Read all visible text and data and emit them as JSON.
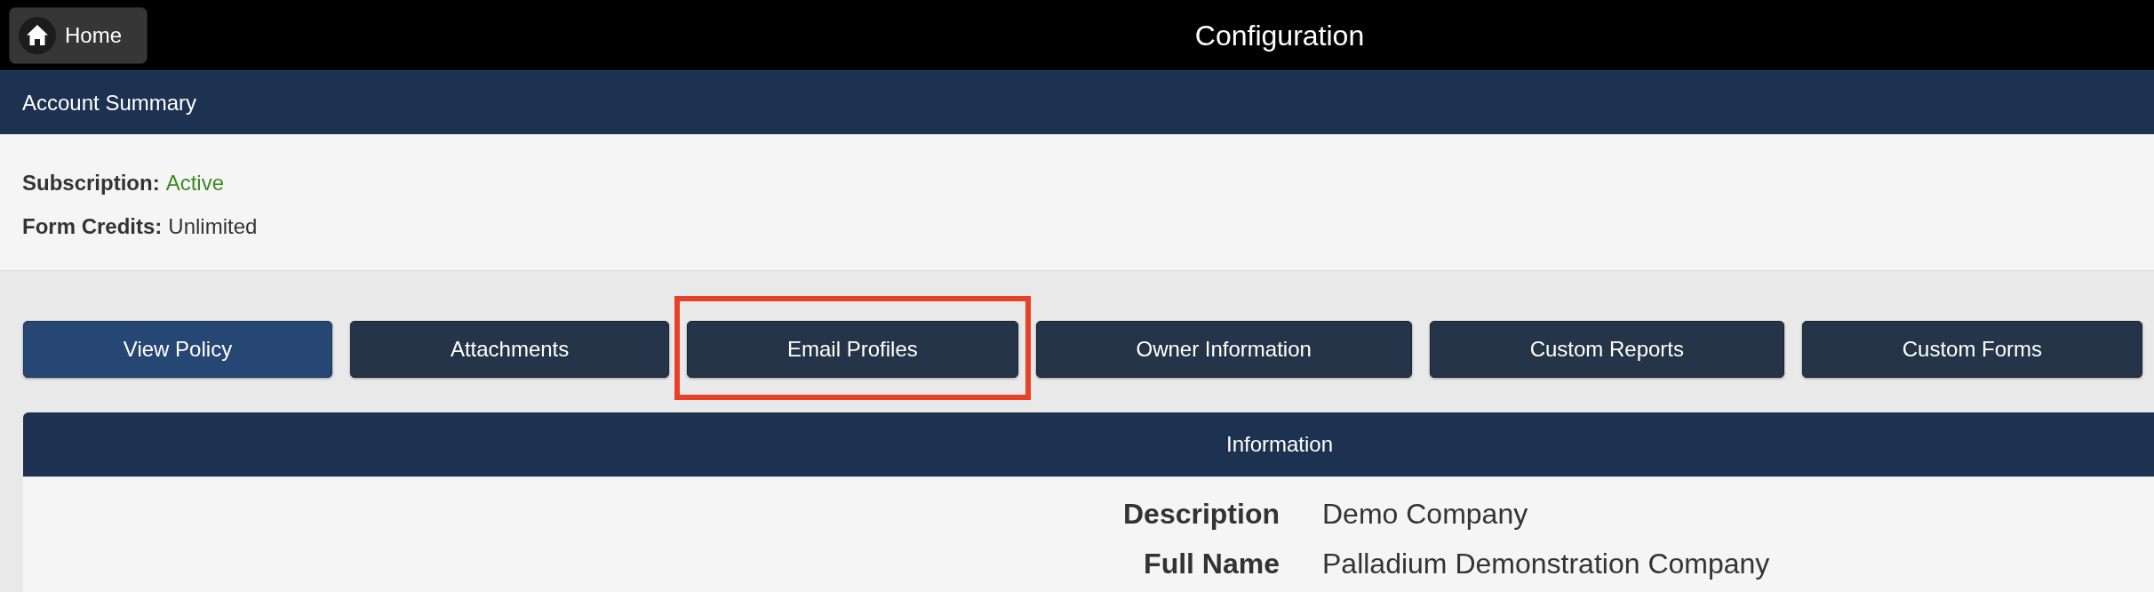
{
  "top_bar": {
    "home_button": "Home",
    "title": "Configuration"
  },
  "account_summary": {
    "title": "Account Summary",
    "fields": [
      {
        "label": "Subscription:",
        "value": "Active",
        "kind": "status"
      },
      {
        "label": "Form Credits:",
        "value": "Unlimited",
        "kind": "plain"
      }
    ]
  },
  "buttons": [
    {
      "label": "View Policy",
      "selected": true,
      "highlighted": false
    },
    {
      "label": "Attachments",
      "selected": false,
      "highlighted": false
    },
    {
      "label": "Email Profiles",
      "selected": false,
      "highlighted": true
    },
    {
      "label": "Owner Information",
      "selected": false,
      "highlighted": false
    },
    {
      "label": "Custom Reports",
      "selected": false,
      "highlighted": false
    },
    {
      "label": "Custom Forms",
      "selected": false,
      "highlighted": false
    }
  ],
  "information": {
    "title": "Information",
    "rows": [
      {
        "label": "Description",
        "value": "Demo Company"
      },
      {
        "label": "Full Name",
        "value": "Palladium Demonstration Company"
      }
    ]
  }
}
